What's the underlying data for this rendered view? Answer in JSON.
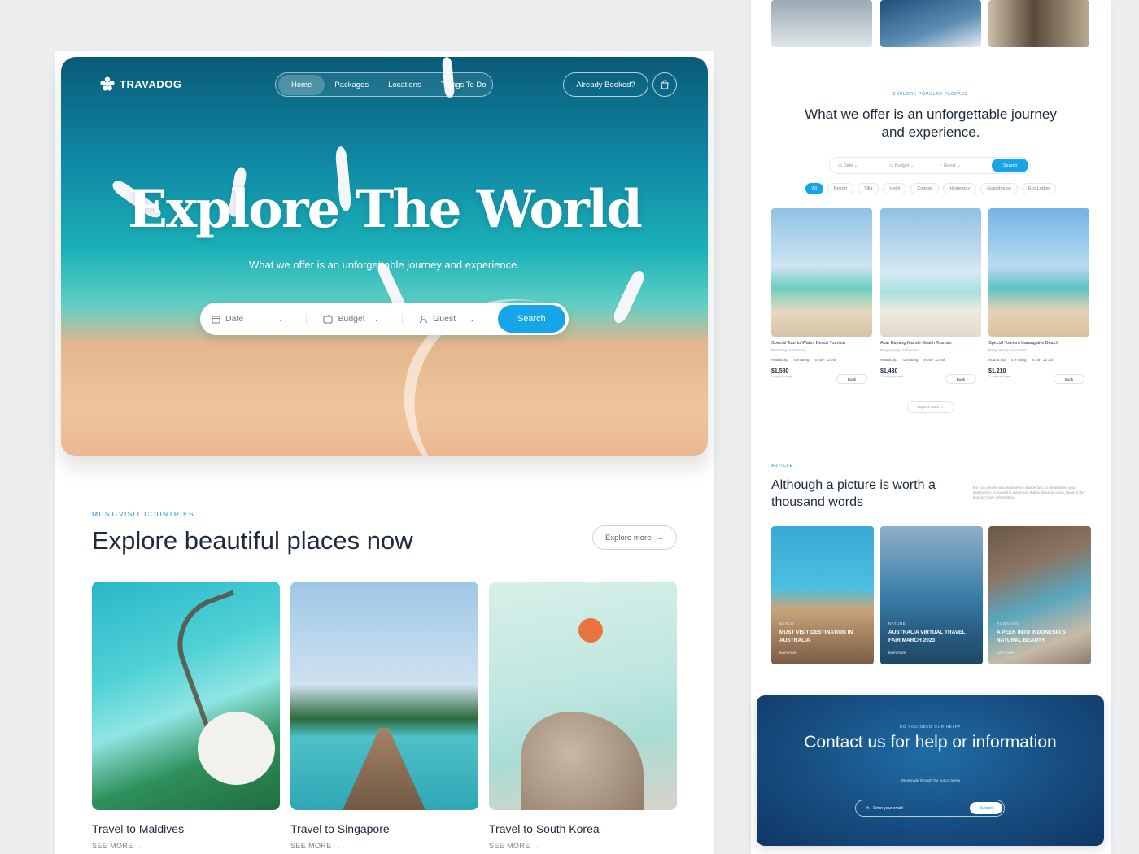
{
  "left": {
    "brand": "TRAVADOG",
    "nav": [
      "Home",
      "Packages",
      "Locations",
      "Things To Do"
    ],
    "already_booked": "Already Booked?",
    "hero_title": "Explore The World",
    "hero_subtitle": "What we offer is an unforgettable journey and experience.",
    "search": {
      "date": "Date",
      "budget": "Budget",
      "guest": "Guest",
      "button": "Search"
    },
    "section_tag": "MUST-VISIT COUNTRIES",
    "section_title": "Explore beautiful places now",
    "explore_more": "Explore more",
    "destinations": [
      {
        "title": "Travel to Maldives",
        "link": "SEE MORE"
      },
      {
        "title": "Travel to Singapore",
        "link": "SEE MORE"
      },
      {
        "title": "Travel to South Korea",
        "link": "SEE MORE"
      }
    ]
  },
  "right": {
    "tag": "EXPLORE POPULAR PACKAGE",
    "title": "What we offer is an unforgettable journey and experience.",
    "mini_search": {
      "date": "Date",
      "budget": "Budget",
      "guest": "Guest",
      "button": "Search"
    },
    "filters": [
      "All",
      "Resort",
      "Villa",
      "Hotel",
      "Cottage",
      "Homestay",
      "Guesthouse",
      "Eco Lodge"
    ],
    "packages": [
      {
        "title": "Special Tour to Wates Beach Tourism",
        "location": "Rembang, Indonesia",
        "trip": "Round trip",
        "rating": "4.9 rating",
        "dates": "8 Jul - 12 Jul",
        "price": "$1,580",
        "duration": "5-day package",
        "book": "Book"
      },
      {
        "title": "Akar Bayang Mande Beach Tourism",
        "location": "Banyuwangi, Indonesia",
        "trip": "Round trip",
        "rating": "4.9 rating",
        "dates": "8 Jul - 12 Jul",
        "price": "$1,430",
        "duration": "12-day package",
        "book": "Book"
      },
      {
        "title": "Special Tourism Karangjahe Beach",
        "location": "Banyuwangi, Indonesia",
        "trip": "Round trip",
        "rating": "4.9 rating",
        "dates": "8 Jul - 12 Jul",
        "price": "$1,210",
        "duration": "7-day package",
        "book": "Book"
      }
    ],
    "explore_more": "Explore more",
    "article_tag": "ARTICLE",
    "article_title": "Although a picture is worth a thousand words",
    "article_desc": "For you people who experience wanderlust, to understand your destination, to know the adventure that is about to come, head to the blog for more information.",
    "articles": [
      {
        "category": "BEACH",
        "title": "MUST VISIT DESTINATION IN AUSTRALIA",
        "link": "learn more"
      },
      {
        "category": "NATURE",
        "title": "AUSTRALIA VIRTUAL TRAVEL FAIR MARCH 2023",
        "link": "learn more"
      },
      {
        "category": "ROMANTIC",
        "title": "A PEEK INTO INDONESIA'S NATURAL BEAUTY",
        "link": "learn more"
      }
    ],
    "contact": {
      "tag": "DO YOU NEED OUR HELP?",
      "title": "Contact us for help or information",
      "subtitle": "We provide through the button below",
      "email_placeholder": "Enter your email",
      "submit": "Submit"
    }
  }
}
